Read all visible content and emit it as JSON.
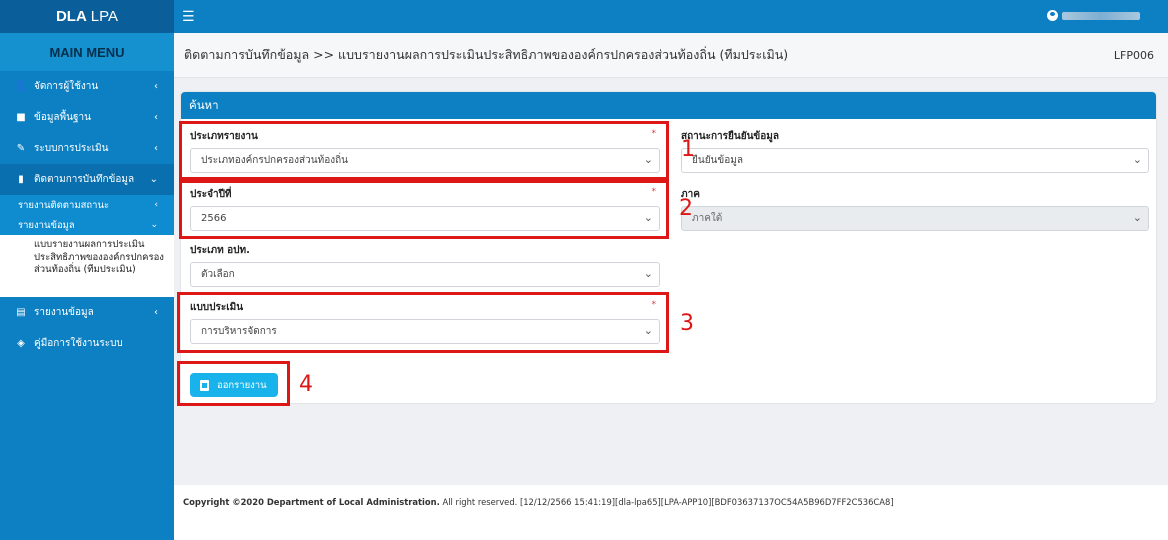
{
  "brand": {
    "bold": "DLA",
    "light": "LPA"
  },
  "sidebar": {
    "main_menu": "MAIN MENU",
    "items": [
      {
        "label": "จัดการผู้ใช้งาน",
        "icon": "user-icon"
      },
      {
        "label": "ข้อมูลพื้นฐาน",
        "icon": "info-icon"
      },
      {
        "label": "ระบบการประเมิน",
        "icon": "document-icon"
      },
      {
        "label": "ติดตามการบันทึกข้อมูล",
        "icon": "file-icon"
      }
    ],
    "sub_items": [
      {
        "label": "รายงานติดตามสถานะ"
      },
      {
        "label": "รายงานข้อมูล"
      }
    ],
    "sub_leaf": "แบบรายงานผลการประเมินประสิทธิภาพขององค์กรปกครองส่วนท้องถิ่น (ทีมประเมิน)",
    "bottom_items": [
      {
        "label": "รายงานข้อมูล",
        "icon": "chart-icon"
      },
      {
        "label": "คู่มือการใช้งานระบบ",
        "icon": "headset-icon"
      }
    ]
  },
  "topbar": {
    "menu_icon": "hamburger-icon"
  },
  "header": {
    "breadcrumb": "ติดตามการบันทึกข้อมูล >> แบบรายงานผลการประเมินประสิทธิภาพขององค์กรปกครองส่วนท้องถิ่น (ทีมประเมิน)",
    "code": "LFP006"
  },
  "search": {
    "title": "ค้นหา",
    "fields": {
      "report_type": {
        "label": "ประเภทรายงาน",
        "value": "ประเภทองค์กรปกครองส่วนท้องถิ่น",
        "required": "*"
      },
      "confirm_status": {
        "label": "สถานะการยืนยันข้อมูล",
        "value": "ยืนยันข้อมูล"
      },
      "year": {
        "label": "ประจำปีที่",
        "value": "2566",
        "required": "*"
      },
      "region": {
        "label": "ภาค",
        "value": "ภาคใต้"
      },
      "lao_type": {
        "label": "ประเภท อปท.",
        "value": "ตัวเลือก"
      },
      "assessment": {
        "label": "แบบประเมิน",
        "value": "การบริหารจัดการ",
        "required": "*"
      }
    },
    "export_button": "ออกรายงาน"
  },
  "annotations": [
    "1",
    "2",
    "3",
    "4"
  ],
  "footer": {
    "copyright_bold": "Copyright ©2020 Department of Local Administration.",
    "copyright_rest": " All right reserved. [12/12/2566 15:41:19][dla-lpa65][LPA-APP10][BDF03637137OC54A5B96D7FF2C536CA8]"
  },
  "colors": {
    "primary": "#0d80c3",
    "accent": "#17b3ea",
    "annotation": "#dd1616"
  }
}
